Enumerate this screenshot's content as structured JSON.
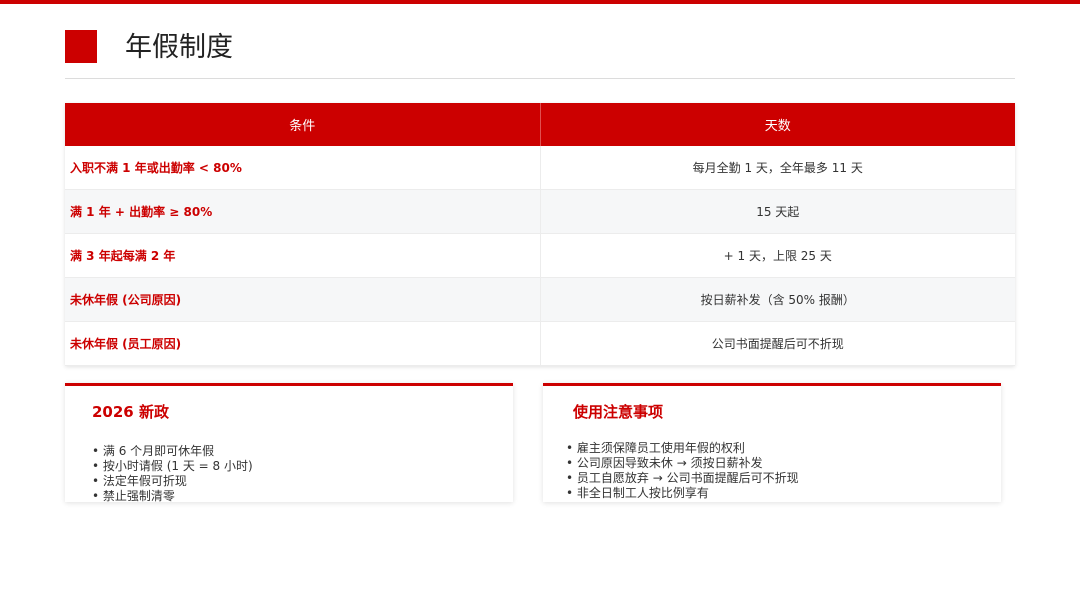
{
  "slide": {
    "title": "年假制度",
    "accent_color": "#cc0000"
  },
  "table": {
    "headers": [
      "条件",
      "天数"
    ],
    "rows": [
      {
        "condition": "入职不满 1 年或出勤率 < 80%",
        "days": "每月全勤 1 天，全年最多 11 天"
      },
      {
        "condition": "满 1 年 + 出勤率 ≥ 80%",
        "days": "15 天起"
      },
      {
        "condition": "满 3 年起每满 2 年",
        "days": "+ 1 天，上限 25 天"
      },
      {
        "condition": "未休年假 (公司原因)",
        "days": "按日薪补发（含 50% 报酬）"
      },
      {
        "condition": "未休年假 (员工原因)",
        "days": "公司书面提醒后可不折现"
      }
    ]
  },
  "cards": {
    "new_policy": {
      "title": "2026 新政",
      "items": [
        "满 6 个月即可休年假",
        "按小时请假 (1 天 = 8 小时)",
        "法定年假可折现",
        "禁止强制清零"
      ]
    },
    "usage_notes": {
      "title": "使用注意事项",
      "items": [
        "雇主须保障员工使用年假的权利",
        "公司原因导致未休 → 须按日薪补发",
        "员工自愿放弃 → 公司书面提醒后可不折现",
        "非全日制工人按比例享有"
      ]
    }
  }
}
